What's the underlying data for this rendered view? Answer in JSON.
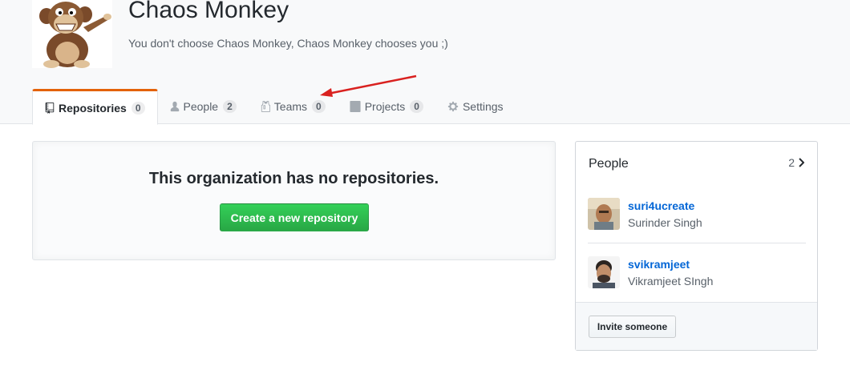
{
  "org": {
    "name": "Chaos Monkey",
    "description": "You don't choose Chaos Monkey, Chaos Monkey chooses you ;)"
  },
  "tabs": [
    {
      "label": "Repositories",
      "count": "0",
      "icon": "repo-icon",
      "active": true
    },
    {
      "label": "People",
      "count": "2",
      "icon": "person-icon"
    },
    {
      "label": "Teams",
      "count": "0",
      "icon": "jersey-icon"
    },
    {
      "label": "Projects",
      "count": "0",
      "icon": "project-icon"
    },
    {
      "label": "Settings",
      "icon": "gear-icon"
    }
  ],
  "blankslate": {
    "message": "This organization has no repositories.",
    "button": "Create a new repository"
  },
  "people": {
    "title": "People",
    "count": "2",
    "members": [
      {
        "login": "suri4ucreate",
        "name": "Surinder Singh"
      },
      {
        "login": "svikramjeet",
        "name": "Vikramjeet SIngh"
      }
    ],
    "invite_button": "Invite someone"
  },
  "colors": {
    "tab_accent": "#e36209",
    "primary_button": "#28a745",
    "link": "#0366d6",
    "annotation_arrow": "#d9211f"
  }
}
